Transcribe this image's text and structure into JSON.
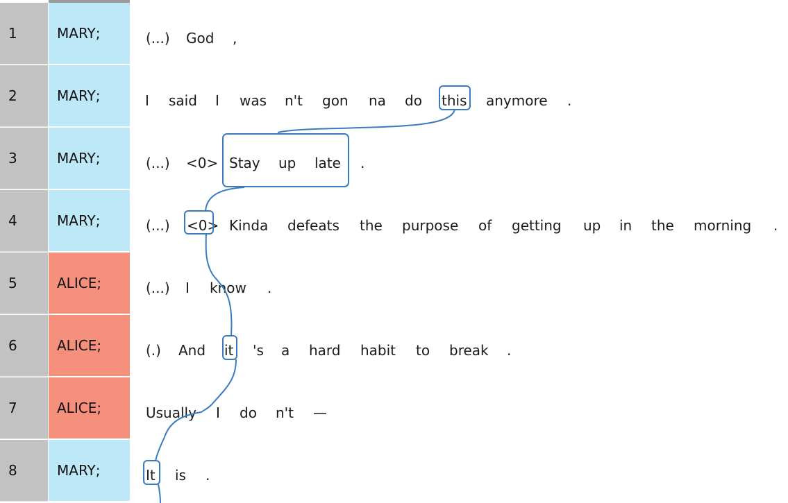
{
  "rows": [
    {
      "num": "1",
      "speaker": "MARY;",
      "tokens": [
        "(...)",
        "God",
        ","
      ]
    },
    {
      "num": "2",
      "speaker": "MARY;",
      "tokens": [
        "I",
        "said",
        "I",
        "was",
        "n't",
        "gon",
        "na",
        "do",
        "this",
        "anymore",
        "."
      ]
    },
    {
      "num": "3",
      "speaker": "MARY;",
      "tokens": [
        "(...)",
        "<0>",
        "Stay",
        "up",
        "late",
        "."
      ]
    },
    {
      "num": "4",
      "speaker": "MARY;",
      "tokens": [
        "(...)",
        "<0>",
        "Kinda",
        "defeats",
        "the",
        "purpose",
        "of",
        "getting",
        "up",
        "in",
        "the",
        "morning",
        "."
      ]
    },
    {
      "num": "5",
      "speaker": "ALICE;",
      "tokens": [
        "(...)",
        "I",
        "know",
        "."
      ]
    },
    {
      "num": "6",
      "speaker": "ALICE;",
      "tokens": [
        "(.)",
        "And",
        "it",
        "'s",
        "a",
        "hard",
        "habit",
        "to",
        "break",
        "."
      ]
    },
    {
      "num": "7",
      "speaker": "ALICE;",
      "tokens": [
        "Usually",
        "I",
        "do",
        "n't",
        "—"
      ]
    },
    {
      "num": "8",
      "speaker": "MARY;",
      "tokens": [
        "It",
        "is",
        "."
      ]
    }
  ],
  "colors": {
    "mary": "#bde8f8",
    "alice": "#f4907c",
    "link": "#3a7bbf",
    "number_column": "#c2c2c2"
  }
}
